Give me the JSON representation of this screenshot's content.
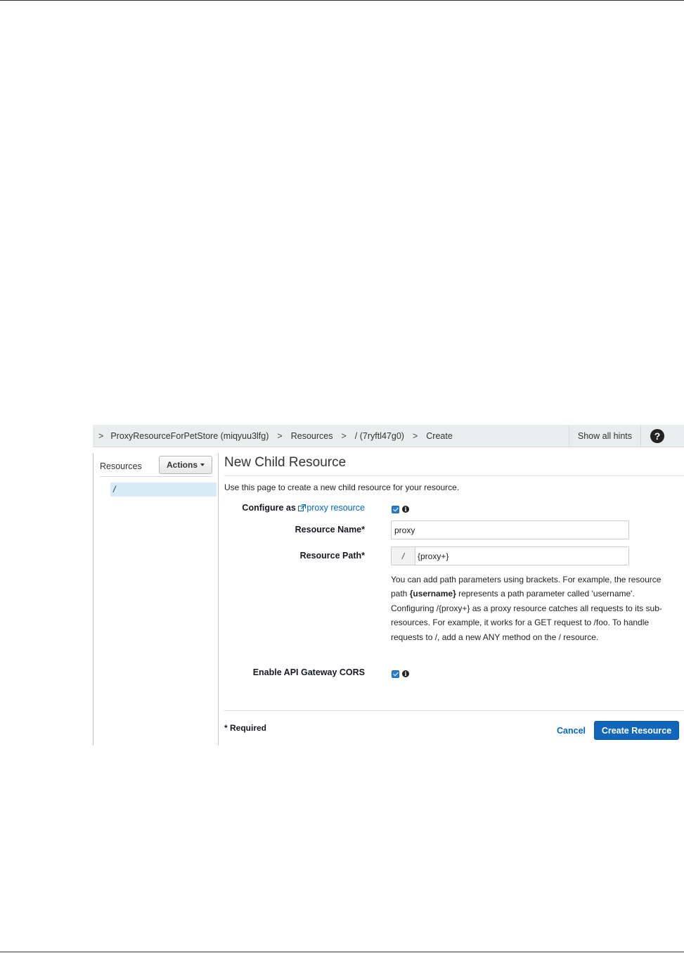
{
  "breadcrumb": {
    "items": [
      {
        "label": "ProxyResourceForPetStore (miqyuu3lfg)"
      },
      {
        "label": "Resources"
      },
      {
        "label": "/ (7ryftl47g0)"
      },
      {
        "label": "Create"
      }
    ],
    "separator": ">"
  },
  "header": {
    "show_hints_label": "Show all hints",
    "help_icon_glyph": "?"
  },
  "left_panel": {
    "title": "Resources",
    "actions_label": "Actions",
    "tree_root": "/"
  },
  "main": {
    "title": "New Child Resource",
    "intro": "Use this page to create a new child resource for your resource.",
    "configure_label": "Configure as",
    "proxy_link": "proxy resource",
    "configure_checked": true,
    "resource_name_label": "Resource Name*",
    "resource_name_value": "proxy",
    "resource_path_label": "Resource Path*",
    "resource_path_prefix": "/",
    "resource_path_value": "{proxy+}",
    "help_text": {
      "part1": "You can add path parameters using brackets. For example, the resource path ",
      "bold": "{username}",
      "part2": " represents a path parameter called 'username'. Configuring /{proxy+} as a proxy resource catches all requests to its sub-resources. For example, it works for a GET request to /foo. To handle requests to /, add a new ANY method on the / resource."
    },
    "cors_label": "Enable API Gateway CORS",
    "cors_checked": true,
    "required_note": "* Required",
    "cancel_label": "Cancel",
    "create_label": "Create Resource",
    "info_glyph": "i"
  },
  "colors": {
    "link": "#0066cc",
    "primary_button": "#1166bb",
    "selected_tree": "#d6eaf8",
    "crumb_bar": "#eaeded"
  },
  "icons": [
    "help-icon",
    "info-icon",
    "external-link-icon",
    "checkbox-checked-icon",
    "caret-down-icon"
  ]
}
